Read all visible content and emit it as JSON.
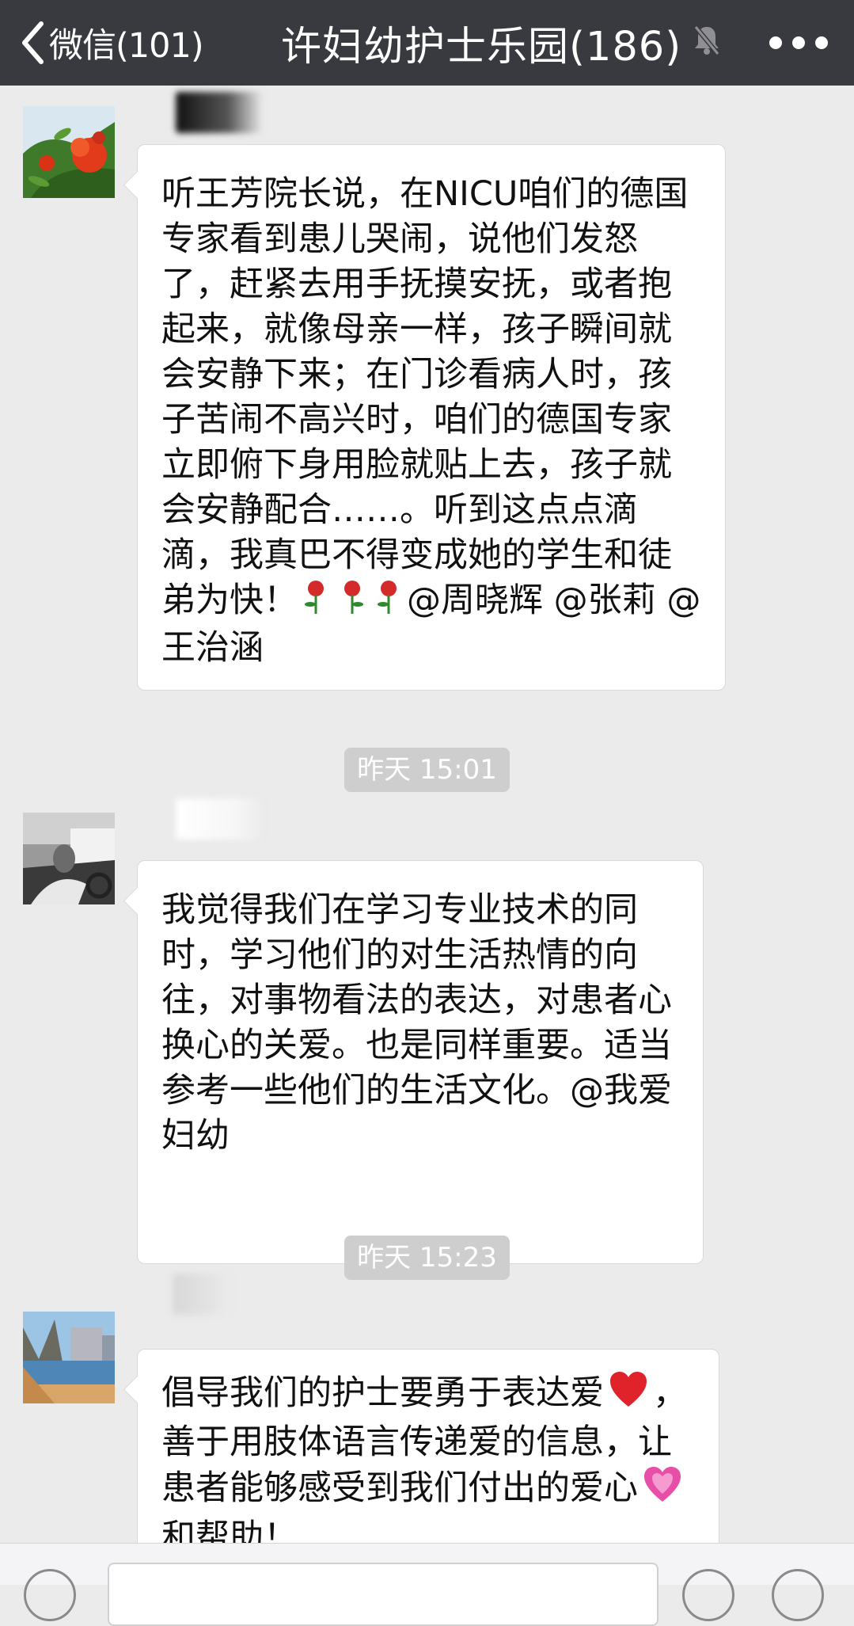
{
  "navbar": {
    "back_label": "微信(101)",
    "title": "许妇幼护士乐园(186)",
    "mute_icon": "bell-muted-icon",
    "more_icon": "ellipsis-icon"
  },
  "messages": [
    {
      "text": "听王芳院长说，在NICU咱们的德国专家看到患儿哭闹，说他们发怒了，赶紧去用手抚摸安抚，或者抱起来，就像母亲一样，孩子瞬间就会安静下来；在门诊看病人时，孩子苦闹不高兴时，咱们的德国专家立即俯下身用脸就贴上去，孩子就会安静配合……。听到这点点滴滴，我真巴不得变成她的学生和徒弟为快！",
      "emoji": "rose-icon ×3",
      "text_end": "@周晓辉 @张莉 @王治涵"
    },
    {
      "text": "我觉得我们在学习专业技术的同时，学习他们的对生活热情的向往，对事物看法的表达，对患者心换心的关爱。也是同样重要。适当参考一些他们的生活文化。@我爱妇幼"
    },
    {
      "text_a": "倡导我们的护士要勇于表达爱",
      "text_b": "，善于用肢体语言传递爱的信息，让患者能够感受到我们付出的爱心",
      "text_c": "和帮助！"
    }
  ],
  "timestamps": [
    "昨天 15:01",
    "昨天 15:23"
  ],
  "colors": {
    "navbar": "#393a3f",
    "chat_bg": "#ebebeb",
    "bubble": "#ffffff",
    "timestamp_bg": "#cecece"
  }
}
